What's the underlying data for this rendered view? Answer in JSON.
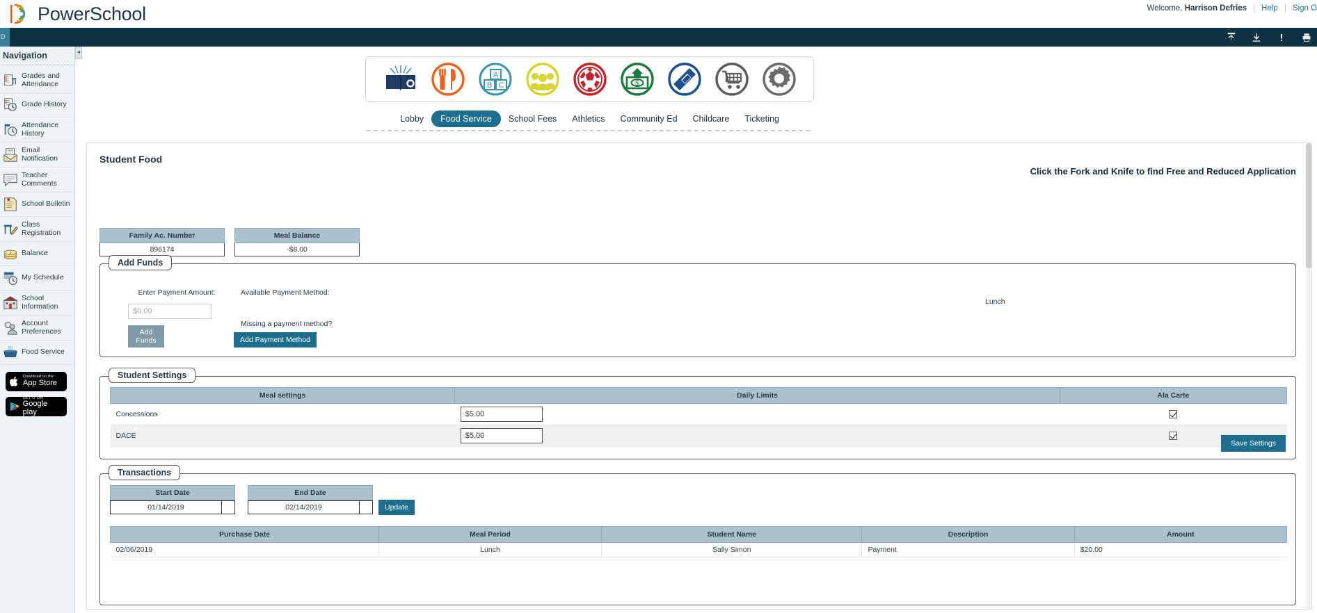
{
  "header": {
    "brand": "PowerSchool",
    "welcome_prefix": "Welcome,",
    "user_name": "Harrison Defries",
    "help_label": "Help",
    "signout_label": "Sign O",
    "separator": "|"
  },
  "darkbar": {
    "left_label": "D",
    "icons": [
      "share-icon",
      "download-icon",
      "alert-icon",
      "print-icon"
    ]
  },
  "sidebar": {
    "title": "Navigation",
    "items": [
      {
        "label": "Grades and Attendance",
        "icon": "grades-attendance-icon"
      },
      {
        "label": "Grade History",
        "icon": "grade-history-icon"
      },
      {
        "label": "Attendance History",
        "icon": "attendance-history-icon"
      },
      {
        "label": "Email Notification",
        "icon": "email-icon"
      },
      {
        "label": "Teacher Comments",
        "icon": "comments-icon"
      },
      {
        "label": "School Bulletin",
        "icon": "bulletin-icon"
      },
      {
        "label": "Class Registration",
        "icon": "class-registration-icon"
      },
      {
        "label": "Balance",
        "icon": "balance-coins-icon"
      },
      {
        "label": "My Schedule",
        "icon": "schedule-icon"
      },
      {
        "label": "School Information",
        "icon": "school-building-icon"
      },
      {
        "label": "Account Preferences",
        "icon": "account-preferences-icon"
      },
      {
        "label": "Food Service",
        "icon": "food-service-icon"
      }
    ],
    "badges": [
      {
        "small": "Download on the",
        "big": "App Store",
        "icon": "apple-icon"
      },
      {
        "small": "GET IT ON",
        "big": "Google play",
        "icon": "google-play-icon"
      }
    ]
  },
  "service_icons": [
    {
      "name": "lobby-book-icon",
      "color": "#1f3c64"
    },
    {
      "name": "food-service-fork-knife-icon",
      "color": "#e8621d"
    },
    {
      "name": "school-fees-abc-icon",
      "color": "#3c92ab"
    },
    {
      "name": "community-ed-people-icon",
      "color": "#d6d433"
    },
    {
      "name": "athletics-soccer-icon",
      "color": "#c0262c"
    },
    {
      "name": "money-icon",
      "color": "#1c7a3e"
    },
    {
      "name": "ticketing-icon",
      "color": "#1a4f8a"
    },
    {
      "name": "childcare-cart-icon",
      "color": "#5b5b5b"
    },
    {
      "name": "settings-gear-icon",
      "color": "#6a6a6a"
    }
  ],
  "tabs": [
    {
      "label": "Lobby",
      "active": false
    },
    {
      "label": "Food Service",
      "active": true
    },
    {
      "label": "School Fees",
      "active": false
    },
    {
      "label": "Athletics",
      "active": false
    },
    {
      "label": "Community Ed",
      "active": false
    },
    {
      "label": "Childcare",
      "active": false
    },
    {
      "label": "Ticketing",
      "active": false
    }
  ],
  "page": {
    "title": "Student Food",
    "hint": "Click the Fork and Knife to find Free and Reduced Application"
  },
  "summary": {
    "family_account": {
      "header": "Family Ac. Number",
      "value": "896174"
    },
    "meal_balance": {
      "header": "Meal Balance",
      "value": "-$8.00"
    }
  },
  "add_funds": {
    "legend": "Add Funds",
    "amount_label": "Enter Payment Amount:",
    "amount_placeholder": "$0.00",
    "amount_value": "",
    "add_funds_button": "Add Funds",
    "available_method_label": "Available Payment Method:",
    "missing_method_label": "Missing a payment method?",
    "add_method_button": "Add Payment Method",
    "right_note": "Lunch"
  },
  "student_settings": {
    "legend": "Student Settings",
    "columns": [
      "Meal settings",
      "Daily Limits",
      "Ala Carte"
    ],
    "rows": [
      {
        "meal": "Concessions",
        "limit": "$5.00",
        "ala_carte": true
      },
      {
        "meal": "DACE",
        "limit": "$5.00",
        "ala_carte": true
      }
    ],
    "save_button": "Save Settings"
  },
  "transactions": {
    "legend": "Transactions",
    "start_date_label": "Start Date",
    "start_date_value": "01/14/2019",
    "end_date_label": "End Date",
    "end_date_value": "02/14/2019",
    "update_button": "Update",
    "columns": [
      "Purchase Date",
      "Meal Period",
      "Student Name",
      "Description",
      "Amount"
    ],
    "rows": [
      {
        "purchase_date": "02/06/2019",
        "meal_period": "Lunch",
        "student_name": "Sally Simon",
        "description": "Payment",
        "amount": "$20.00"
      }
    ]
  },
  "colors": {
    "brand_dark": "#0d3244",
    "accent_teal": "#1d6e8e",
    "table_header": "#a9c2cf",
    "sidebar_bg": "#eef3f8"
  }
}
